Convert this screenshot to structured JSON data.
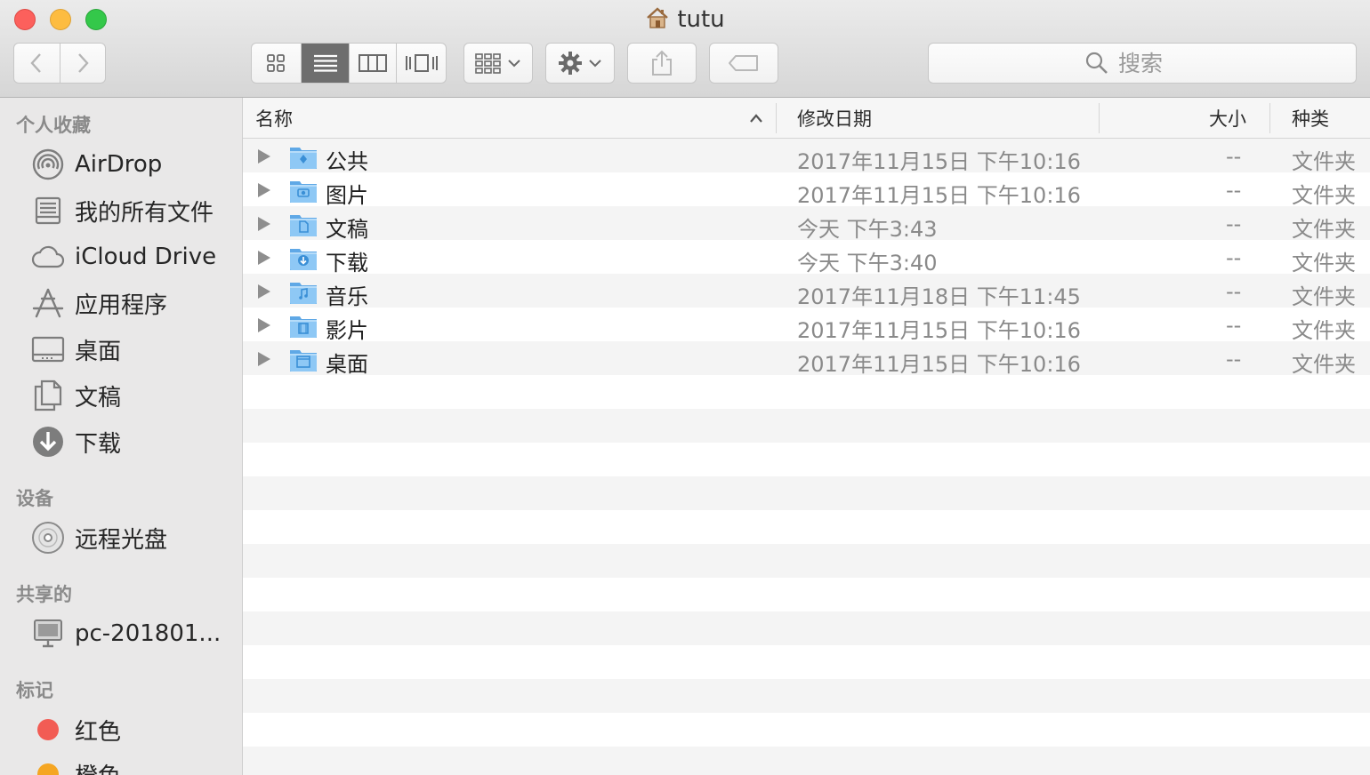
{
  "window": {
    "title": "tutu"
  },
  "toolbar": {
    "search_placeholder": "搜索"
  },
  "sidebar": {
    "sections": [
      {
        "header": "个人收藏",
        "items": [
          {
            "label": "AirDrop",
            "icon": "airdrop-icon"
          },
          {
            "label": "我的所有文件",
            "icon": "all-files-icon"
          },
          {
            "label": "iCloud Drive",
            "icon": "cloud-icon"
          },
          {
            "label": "应用程序",
            "icon": "applications-icon"
          },
          {
            "label": "桌面",
            "icon": "desktop-icon"
          },
          {
            "label": "文稿",
            "icon": "documents-icon"
          },
          {
            "label": "下载",
            "icon": "downloads-icon"
          }
        ]
      },
      {
        "header": "设备",
        "items": [
          {
            "label": "远程光盘",
            "icon": "disc-icon"
          }
        ]
      },
      {
        "header": "共享的",
        "items": [
          {
            "label": "pc-201801...",
            "icon": "computer-icon"
          }
        ]
      },
      {
        "header": "标记",
        "items": [
          {
            "label": "红色",
            "icon": "tag-red-icon"
          },
          {
            "label": "橙色",
            "icon": "tag-orange-icon"
          }
        ]
      }
    ]
  },
  "list": {
    "columns": {
      "name": "名称",
      "date": "修改日期",
      "size": "大小",
      "kind": "种类"
    },
    "rows": [
      {
        "name": "公共",
        "date": "2017年11月15日 下午10:16",
        "size": "--",
        "kind": "文件夹",
        "badge": "public"
      },
      {
        "name": "图片",
        "date": "2017年11月15日 下午10:16",
        "size": "--",
        "kind": "文件夹",
        "badge": "camera"
      },
      {
        "name": "文稿",
        "date": "今天 下午3:43",
        "size": "--",
        "kind": "文件夹",
        "badge": "doc"
      },
      {
        "name": "下载",
        "date": "今天 下午3:40",
        "size": "--",
        "kind": "文件夹",
        "badge": "download"
      },
      {
        "name": "音乐",
        "date": "2017年11月18日 下午11:45",
        "size": "--",
        "kind": "文件夹",
        "badge": "music"
      },
      {
        "name": "影片",
        "date": "2017年11月15日 下午10:16",
        "size": "--",
        "kind": "文件夹",
        "badge": "film"
      },
      {
        "name": "桌面",
        "date": "2017年11月15日 下午10:16",
        "size": "--",
        "kind": "文件夹",
        "badge": "desktop"
      }
    ]
  },
  "colors": {
    "tag_red": "#f25c54",
    "tag_orange": "#f5a623",
    "folder": "#6fb3ec",
    "stripe": "#f4f4f4"
  }
}
